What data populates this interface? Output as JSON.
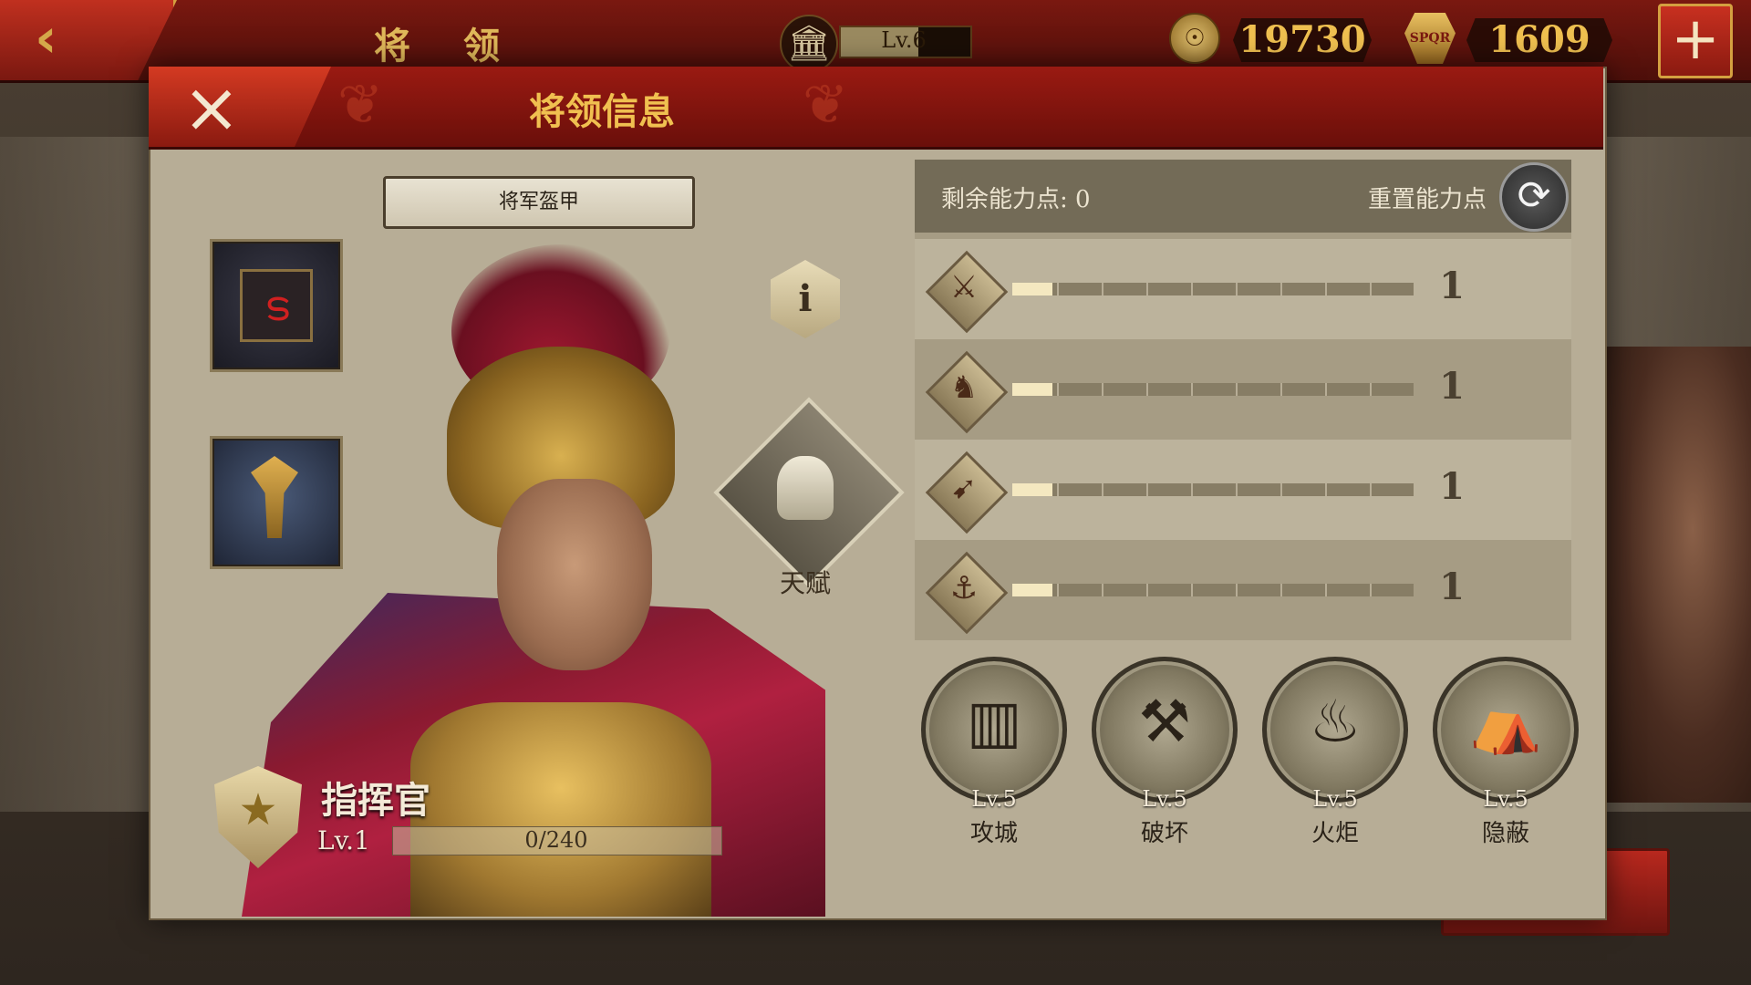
{
  "topbar": {
    "back_icon": "‹",
    "title": "将 领",
    "level_icon": "🏛",
    "level": "Lv.6",
    "level_progress": 0.6,
    "coin_icon": "coin-icon",
    "coins": "19730",
    "spqr_icon": "spqr-icon",
    "spqr": "1609",
    "add_icon": "+"
  },
  "dialog": {
    "close_icon": "×",
    "title": "将领信息"
  },
  "left": {
    "armor_button": "将军盔甲",
    "info_icon": "i",
    "talent_label": "天赋",
    "rank_title": "指挥官",
    "rank_level": "Lv.1",
    "xp_text": "0/240",
    "xp_fraction": 0
  },
  "right": {
    "points_label": "剩余能力点: 0",
    "reset_label": "重置能力点",
    "reset_icon": "⟳",
    "stats": [
      {
        "icon": "sword-icon",
        "glyph": "⚔",
        "value": "1",
        "fraction": 0.1
      },
      {
        "icon": "horse-icon",
        "glyph": "♞",
        "value": "1",
        "fraction": 0.1
      },
      {
        "icon": "bow-icon",
        "glyph": "➹",
        "value": "1",
        "fraction": 0.1
      },
      {
        "icon": "anchor-icon",
        "glyph": "⚓",
        "value": "1",
        "fraction": 0.1
      }
    ],
    "skills": [
      {
        "icon": "siege-icon",
        "glyph": "▥",
        "level": "Lv.5",
        "name": "攻城"
      },
      {
        "icon": "destroy-icon",
        "glyph": "⚒",
        "level": "Lv.5",
        "name": "破坏"
      },
      {
        "icon": "torch-icon",
        "glyph": "♨",
        "level": "Lv.5",
        "name": "火炬"
      },
      {
        "icon": "stealth-icon",
        "glyph": "⛺",
        "level": "Lv.5",
        "name": "隐蔽"
      }
    ]
  },
  "colors": {
    "accent_red": "#9a1a12",
    "gold": "#f0c050",
    "panel_tan": "#b7ad96"
  }
}
